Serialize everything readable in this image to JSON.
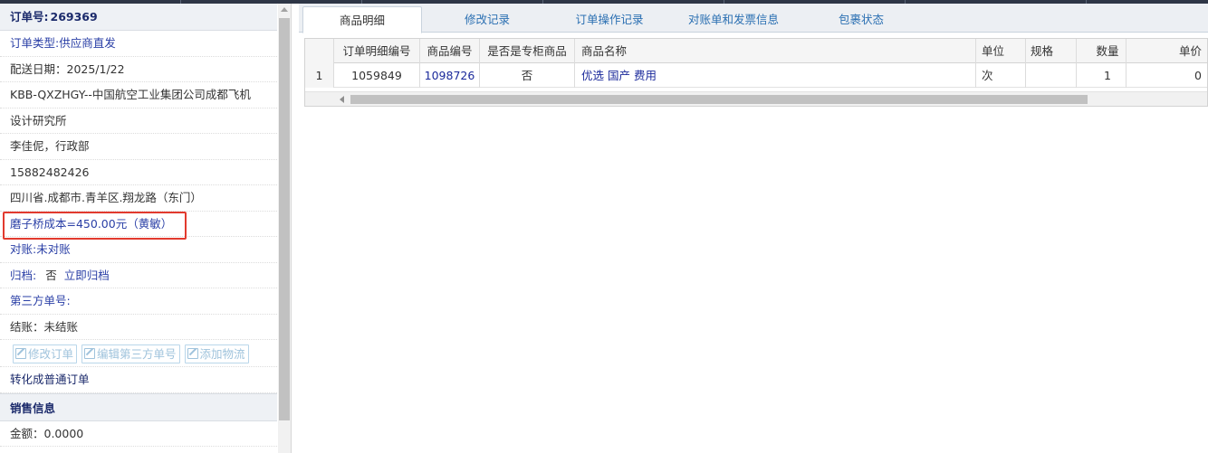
{
  "order": {
    "header_label": "订单号:",
    "number": "269369",
    "type_label": "订单类型:",
    "type_value": "供应商直发",
    "delivery_date": "配送日期：2025/1/22",
    "customer_line1": "KBB-QXZHGY--中国航空工业集团公司成都飞机",
    "customer_line2": "设计研究所",
    "contact": "李佳伲，行政部",
    "phone": "15882482426",
    "address": "四川省.成都市.青羊区.翔龙路（东门）",
    "cost_note": "磨子桥成本=450.00元（黄敏）",
    "reconcile_label": "对账:",
    "reconcile_value": "未对账",
    "archive_label": "归档:",
    "archive_value": "否",
    "archive_link": "立即归档",
    "third_party_label": "第三方单号:",
    "settle": "结账：未结账",
    "actions": [
      "修改订单",
      "编辑第三方单号",
      "添加物流"
    ],
    "convert_link": "转化成普通订单",
    "sales_section": "销售信息",
    "amount": "金额：0.0000"
  },
  "tabs": [
    {
      "label": "商品明细",
      "active": true
    },
    {
      "label": "修改记录",
      "active": false
    },
    {
      "label": "订单操作记录",
      "active": false
    },
    {
      "label": "对账单和发票信息",
      "active": false
    },
    {
      "label": "包裹状态",
      "active": false
    }
  ],
  "grid": {
    "columns": [
      "订单明细编号",
      "商品编号",
      "是否是专柜商品",
      "商品名称",
      "单位",
      "规格",
      "数量",
      "单价"
    ],
    "rows": [
      {
        "rownum": "1",
        "detail_id": "1059849",
        "product_id": "1098726",
        "counter": "否",
        "name": "优选 国产 费用",
        "unit": "次",
        "spec": "",
        "qty": "1",
        "price": "0"
      }
    ]
  },
  "colors": {
    "highlight": "#e23a2e",
    "link": "#2a3fa6",
    "tab_link": "#2a6fb2"
  }
}
